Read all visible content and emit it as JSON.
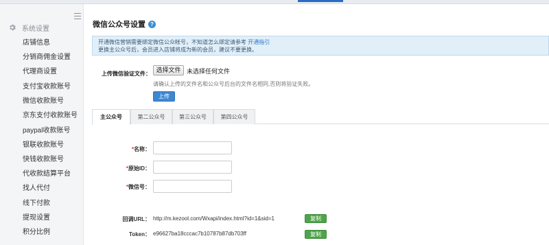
{
  "sidebar": {
    "section_label": "系统设置",
    "items": [
      {
        "label": "店铺信息"
      },
      {
        "label": "分销商佣金设置"
      },
      {
        "label": "代理商设置"
      },
      {
        "label": "支付宝收款账号"
      },
      {
        "label": "微信收款账号"
      },
      {
        "label": "京东支付收款账号"
      },
      {
        "label": "paypal收款账号"
      },
      {
        "label": "银联收款账号"
      },
      {
        "label": "快钱收款账号"
      },
      {
        "label": "代收款结算平台"
      },
      {
        "label": "找人代付"
      },
      {
        "label": "线下付款"
      },
      {
        "label": "提现设置"
      },
      {
        "label": "积分比例"
      }
    ]
  },
  "page": {
    "title": "微信公众号设置",
    "help": "?"
  },
  "notice": {
    "line1": "开通微信营销需要绑定微信公众帐号，不知道怎么绑定请参考",
    "link": "开通指引",
    "line2": "更换主公众号后，会员进入店铺将成为新的会员，建议不要更换。"
  },
  "upload": {
    "label": "上传微信验证文件：",
    "choose_button": "选择文件",
    "no_file": "未选择任何文件",
    "hint": "请确认上传的文件名和公众号后台的文件名相同,否则将验证失败。",
    "submit_button": "上传"
  },
  "tabs": [
    {
      "label": "主公众号",
      "active": true
    },
    {
      "label": "第二公众号",
      "active": false
    },
    {
      "label": "第三公众号",
      "active": false
    },
    {
      "label": "第四公众号",
      "active": false
    }
  ],
  "form": {
    "required_mark": "*",
    "name_label": "名称：",
    "original_id_label": "原始ID：",
    "wechat_id_label": "微信号：",
    "name_value": "",
    "original_id_value": "",
    "wechat_id_value": ""
  },
  "callback": {
    "url_label": "回调URL：",
    "url_value": "http://m.kezool.com/Wxapi/index.html?id=1&sid=1",
    "token_label": "Token：",
    "token_value": "e96627ba18cccac7b10787b87db703ff",
    "copy_button": "复制"
  },
  "colors": {
    "primary": "#3e88d2",
    "copy_green": "#4ea44a",
    "notice_bg": "#e1eff9",
    "required_red": "#e0352b"
  }
}
